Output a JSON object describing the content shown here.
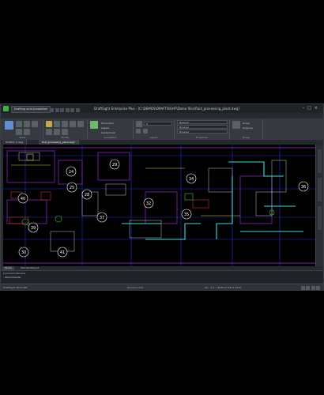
{
  "titlebar": {
    "workspace": "Drafting and Annotation",
    "title": "DraftSight Enterprise Plus - [C:\\DEMOS\\DRAFTSIGHT\\Demo files\\fluid_processing_plant.dwg]"
  },
  "ribbon_tabs": [
    "Home",
    "Insert",
    "Export",
    "Objects",
    "Manage",
    "Annotate",
    "Sheet",
    "Cammands",
    "Manage",
    "View",
    "Express",
    "Workshops"
  ],
  "ribbon_groups": [
    {
      "caption": "Draw"
    },
    {
      "caption": "Modify"
    },
    {
      "caption": "Annotation"
    },
    {
      "caption": "Layers"
    },
    {
      "caption": "Properties"
    },
    {
      "caption": "Group"
    }
  ],
  "ribbon_labels": {
    "dimension": "Dimension",
    "leader": "Leader",
    "centermark": "Centermark",
    "layer_value": "0",
    "color_value": "ByLayer",
    "linestyle_value": "ByLayer",
    "lineweight_value": "ByLayer",
    "group_label": "Group",
    "ungroup_label": "Ungroup"
  },
  "doc_tabs": [
    "STUDIO_5.dwg",
    "fluid_processing_plant.dwg*"
  ],
  "room_numbers": [
    "24",
    "29",
    "34",
    "40",
    "25",
    "32",
    "28",
    "36",
    "39",
    "37",
    "35",
    "30",
    "41"
  ],
  "layout_tabs": [
    "Model",
    "Standardlayout"
  ],
  "command_window": {
    "title": "Command Window",
    "line": ": OCommande:"
  },
  "status": {
    "left": "DraftSight 2019 SP0",
    "center": "Dynamic CCS",
    "right": "(A) - 1:1 - (4836,27,8121.18,0)"
  },
  "colors": {
    "background": "#000000",
    "chrome": "#2b2e33",
    "grid_blue": "#2233c8",
    "grid_magenta": "#9a2bd0",
    "pipe_cyan": "#38e0e0",
    "accent_green": "#3fae4a"
  }
}
